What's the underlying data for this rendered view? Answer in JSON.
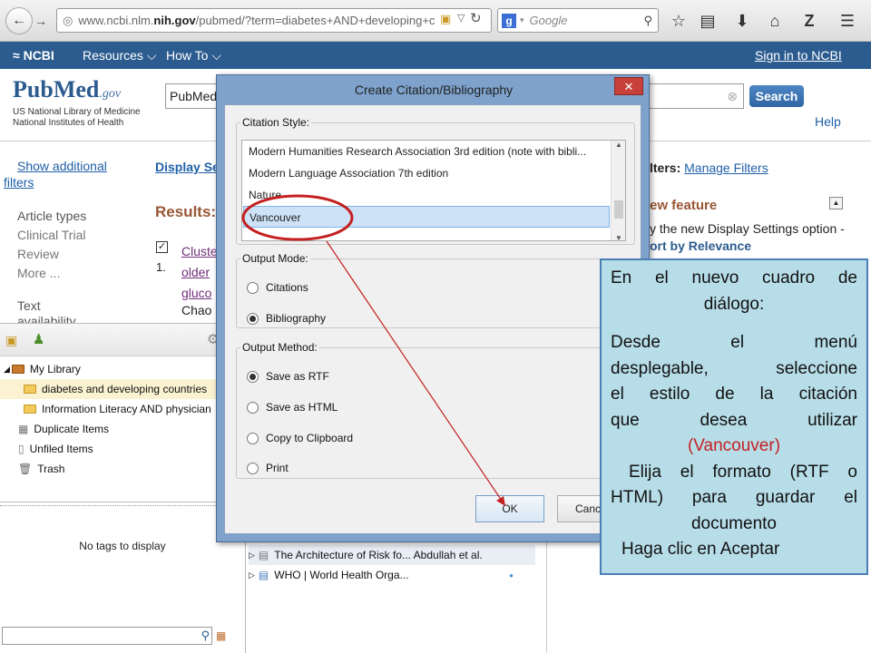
{
  "browser": {
    "url_prefix": "www.ncbi.nlm.",
    "url_host": "nih.gov",
    "url_rest": "/pubmed/?term=diabetes+AND+developing+c",
    "search_placeholder": "Google"
  },
  "ncbi_bar": {
    "logo": "NCBI",
    "resources": "Resources",
    "howto": "How To",
    "signin": "Sign in to NCBI"
  },
  "pubmed": {
    "logo_pub": "Pub",
    "logo_med": "Med",
    "logo_gov": ".gov",
    "org1": "US National Library of Medicine",
    "org2": "National Institutes of Health",
    "search_value": "PubMed",
    "search_button": "Search",
    "help": "Help"
  },
  "left_col": {
    "show_additional": "Show additional",
    "filters": "filters",
    "article_types": "Article types",
    "types": [
      "Clinical Trial",
      "Review",
      "More ..."
    ],
    "text": "Text",
    "availability": "availability"
  },
  "results": {
    "display": "Display Se",
    "label": "Results:",
    "num": "1.",
    "title_lines": [
      "Cluste",
      "older",
      "gluco"
    ],
    "author": "Chao"
  },
  "right_col": {
    "filters_label": "lters: ",
    "manage_filters": "Manage Filters",
    "new_feature": "ew feature",
    "try_text": "y the new Display Settings option -",
    "sort": "ort by Relevance"
  },
  "zotero": {
    "items": [
      {
        "label": "My Library"
      },
      {
        "label": "diabetes and developing countries"
      },
      {
        "label": "Information Literacy AND physician"
      },
      {
        "label": "Duplicate Items"
      },
      {
        "label": "Unfiled Items"
      },
      {
        "label": "Trash"
      }
    ],
    "no_tags": "No tags to display"
  },
  "dialog": {
    "title": "Create Citation/Bibliography",
    "citation_style_label": "Citation Style:",
    "styles": [
      "Modern Humanities Research Association 3rd edition (note with bibli...",
      "Modern Language Association 7th edition",
      "Nature",
      "Vancouver"
    ],
    "output_mode_label": "Output Mode:",
    "modes": [
      "Citations",
      "Bibliography"
    ],
    "output_method_label": "Output Method:",
    "methods": [
      "Save as RTF",
      "Save as HTML",
      "Copy to Clipboard",
      "Print"
    ],
    "ok": "OK",
    "cancel": "Canc"
  },
  "bottom_items": [
    "The Architecture of Risk fo... Abdullah et al.",
    "WHO | World Health Orga..."
  ],
  "callout": {
    "l1": "En el nuevo cuadro de",
    "l2": "diálogo:",
    "l3": "Desde el menú",
    "l4": "desplegable, seleccione",
    "l5": "el estilo de la citación",
    "l6": "que desea utilizar",
    "l7": "(Vancouver)",
    "l8": "Elija el formato (RTF o",
    "l9": "HTML) para guardar el",
    "l10": "documento",
    "l11": "Haga clic en Aceptar"
  },
  "colors": {
    "ncbi_blue": "#2c5c8f",
    "highlight": "#cc2222",
    "callout_bg": "#b7dde8"
  }
}
